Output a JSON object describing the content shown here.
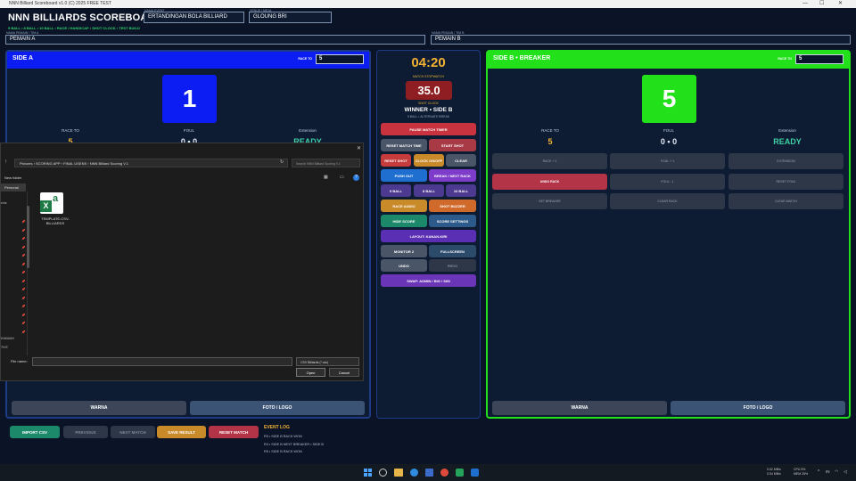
{
  "window": {
    "title": "NNN Billiard Scoreboard v1.0 (C) 2025 FREE TEST"
  },
  "header": {
    "app_title": "NNN BILLIARDS SCOREBOARD",
    "event_label": "NAMA EVENT",
    "event_value": "ERTANDINGAN BOLA BILLIARD",
    "venue_label": "VENUE / MEJA",
    "venue_value": "GLOUNG BRI",
    "modes": "9 BALL • 8 BALL • 10 BALL • RACE / HANDICAP • SHOT CLOCK • TEST BUILD",
    "player_a_label": "NAMA PEMAIN / TIM A",
    "player_a": "PEMAIN A",
    "player_b_label": "NAMA PEMAIN / TIM B",
    "player_b": "PEMAIN B"
  },
  "side_a": {
    "title": "SIDE A",
    "race_label": "RACE TO",
    "race_value": "5",
    "score": "1",
    "stat_race_label": "RACE TO",
    "stat_race_value": "5",
    "stat_foul_label": "FOUL",
    "stat_foul_value": "0 • 0",
    "stat_ext_label": "Extension",
    "stat_ext_value": "READY",
    "color": "#0b1df2",
    "btn_warna": "WARNA",
    "btn_foto": "FOTO / LOGO"
  },
  "side_b": {
    "title": "SIDE B  • BREAKER",
    "race_label": "RACE TO",
    "race_value": "5",
    "score": "5",
    "stat_race_label": "RACE TO",
    "stat_race_value": "5",
    "stat_foul_label": "FOUL",
    "stat_foul_value": "0 • 0",
    "stat_ext_label": "Extension",
    "stat_ext_value": "READY",
    "color": "#22e01a",
    "btns": [
      "RACK + 1",
      "FOUL + 1",
      "EXTENSION",
      "UNDO RACK",
      "FOUL - 1",
      "RESET FOUL",
      "SET BREAKER",
      "CLEAR RACK",
      "CLEAR MATCH"
    ],
    "btn_warna": "WARNA",
    "btn_foto": "FOTO / LOGO"
  },
  "center": {
    "timer": "04:20",
    "stopwatch_label": "MATCH STOPWATCH",
    "shot_clock": "35.0",
    "shot_label": "SHOT CLOCK",
    "winner": "WINNER • SIDE B",
    "winner_sub": "9 BALL • ALTERNATE BREAK",
    "btn_pause": "PAUSE MATCH TIMER",
    "btn_reset_match_time": "RESET MATCH TIME",
    "btn_start_shot": "START SHOT",
    "btn_reset_shot": "RESET SHOT",
    "btn_clock_on": "CLOCK ON/OFF",
    "btn_clear": "CLEAR",
    "btn_push_out": "PUSH OUT",
    "btn_break": "BREAK / NEXT RACK",
    "btn_9ball": "9 BALL",
    "btn_8ball": "8 BALL",
    "btn_10ball": "10 BALL",
    "btn_race_audio": "RACE AUDIO",
    "btn_shot_buzzer": "SHOT BUZZER",
    "btn_hide_score": "HIDE SCORE",
    "btn_score_settings": "SCORE SETTINGS",
    "btn_layout": "LAYOUT: KANAN-KIRI",
    "btn_monitor": "MONITOR 2",
    "btn_fullscreen": "FULLSCREEN",
    "btn_undo": "UNDO",
    "btn_redo": "REDO",
    "btn_swap": "SWAP: ADMIN / BIG / SISI"
  },
  "explorer": {
    "breadcrumb": [
      "Pictures",
      "SCORING APP",
      "FINAL USENS",
      "NNN Billiard Scoring V.1"
    ],
    "search_placeholder": "Search NNN Billiard Scoring V.1",
    "new_folder": "New folder",
    "personal": "Personal",
    "file_name": "TEMPLATE-CSV-BILLIARDS",
    "filename_label": "File name:",
    "filter": "CSV Billiards (*.csv)",
    "open": "Open",
    "cancel": "Cancel",
    "nav_items": [
      "ents",
      "KAMAAN",
      "TIVE"
    ]
  },
  "bottom": {
    "import_csv": "IMPORT CSV",
    "previous": "PREVIOUS",
    "next_match": "NEXT MATCH",
    "save_result": "SAVE RESULT",
    "reset_match": "RESET MATCH",
    "event_log_title": "EVENT LOG",
    "event_log": [
      "R3 • SIDE B RACK WON",
      "R4 • SIDE B NEXT BREAKER • SIDE B",
      "R5 • SIDE B RACK WON"
    ]
  },
  "taskbar": {
    "net_up": "0.02 MB/s",
    "net_down": "0.04 MB/s",
    "cpu": "CPU 5%",
    "mem": "MEM 25%",
    "lang": "IN"
  }
}
